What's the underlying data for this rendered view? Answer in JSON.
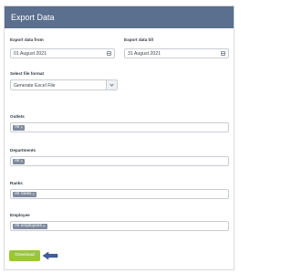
{
  "dialog": {
    "title": "Export Data"
  },
  "dates": {
    "from_label": "Export data from",
    "from_value": "01 August 2021",
    "till_label": "Export data till",
    "till_value": "31 August 2021"
  },
  "file_format": {
    "label": "Select file format",
    "selected": "Generate Excel File"
  },
  "filters": {
    "outlets": {
      "label": "Outlets",
      "tag": "All"
    },
    "departments": {
      "label": "Departments",
      "tag": "All"
    },
    "ranks": {
      "label": "Ranks",
      "tag": "All ranks"
    },
    "employee": {
      "label": "Employee",
      "tag": "All employees"
    }
  },
  "actions": {
    "download_label": "Download"
  },
  "colors": {
    "header_bg": "#5b6f8e",
    "button_bg": "#9bc53d",
    "tag_bg": "#7f8a9c",
    "arrow": "#3f5f9e"
  }
}
